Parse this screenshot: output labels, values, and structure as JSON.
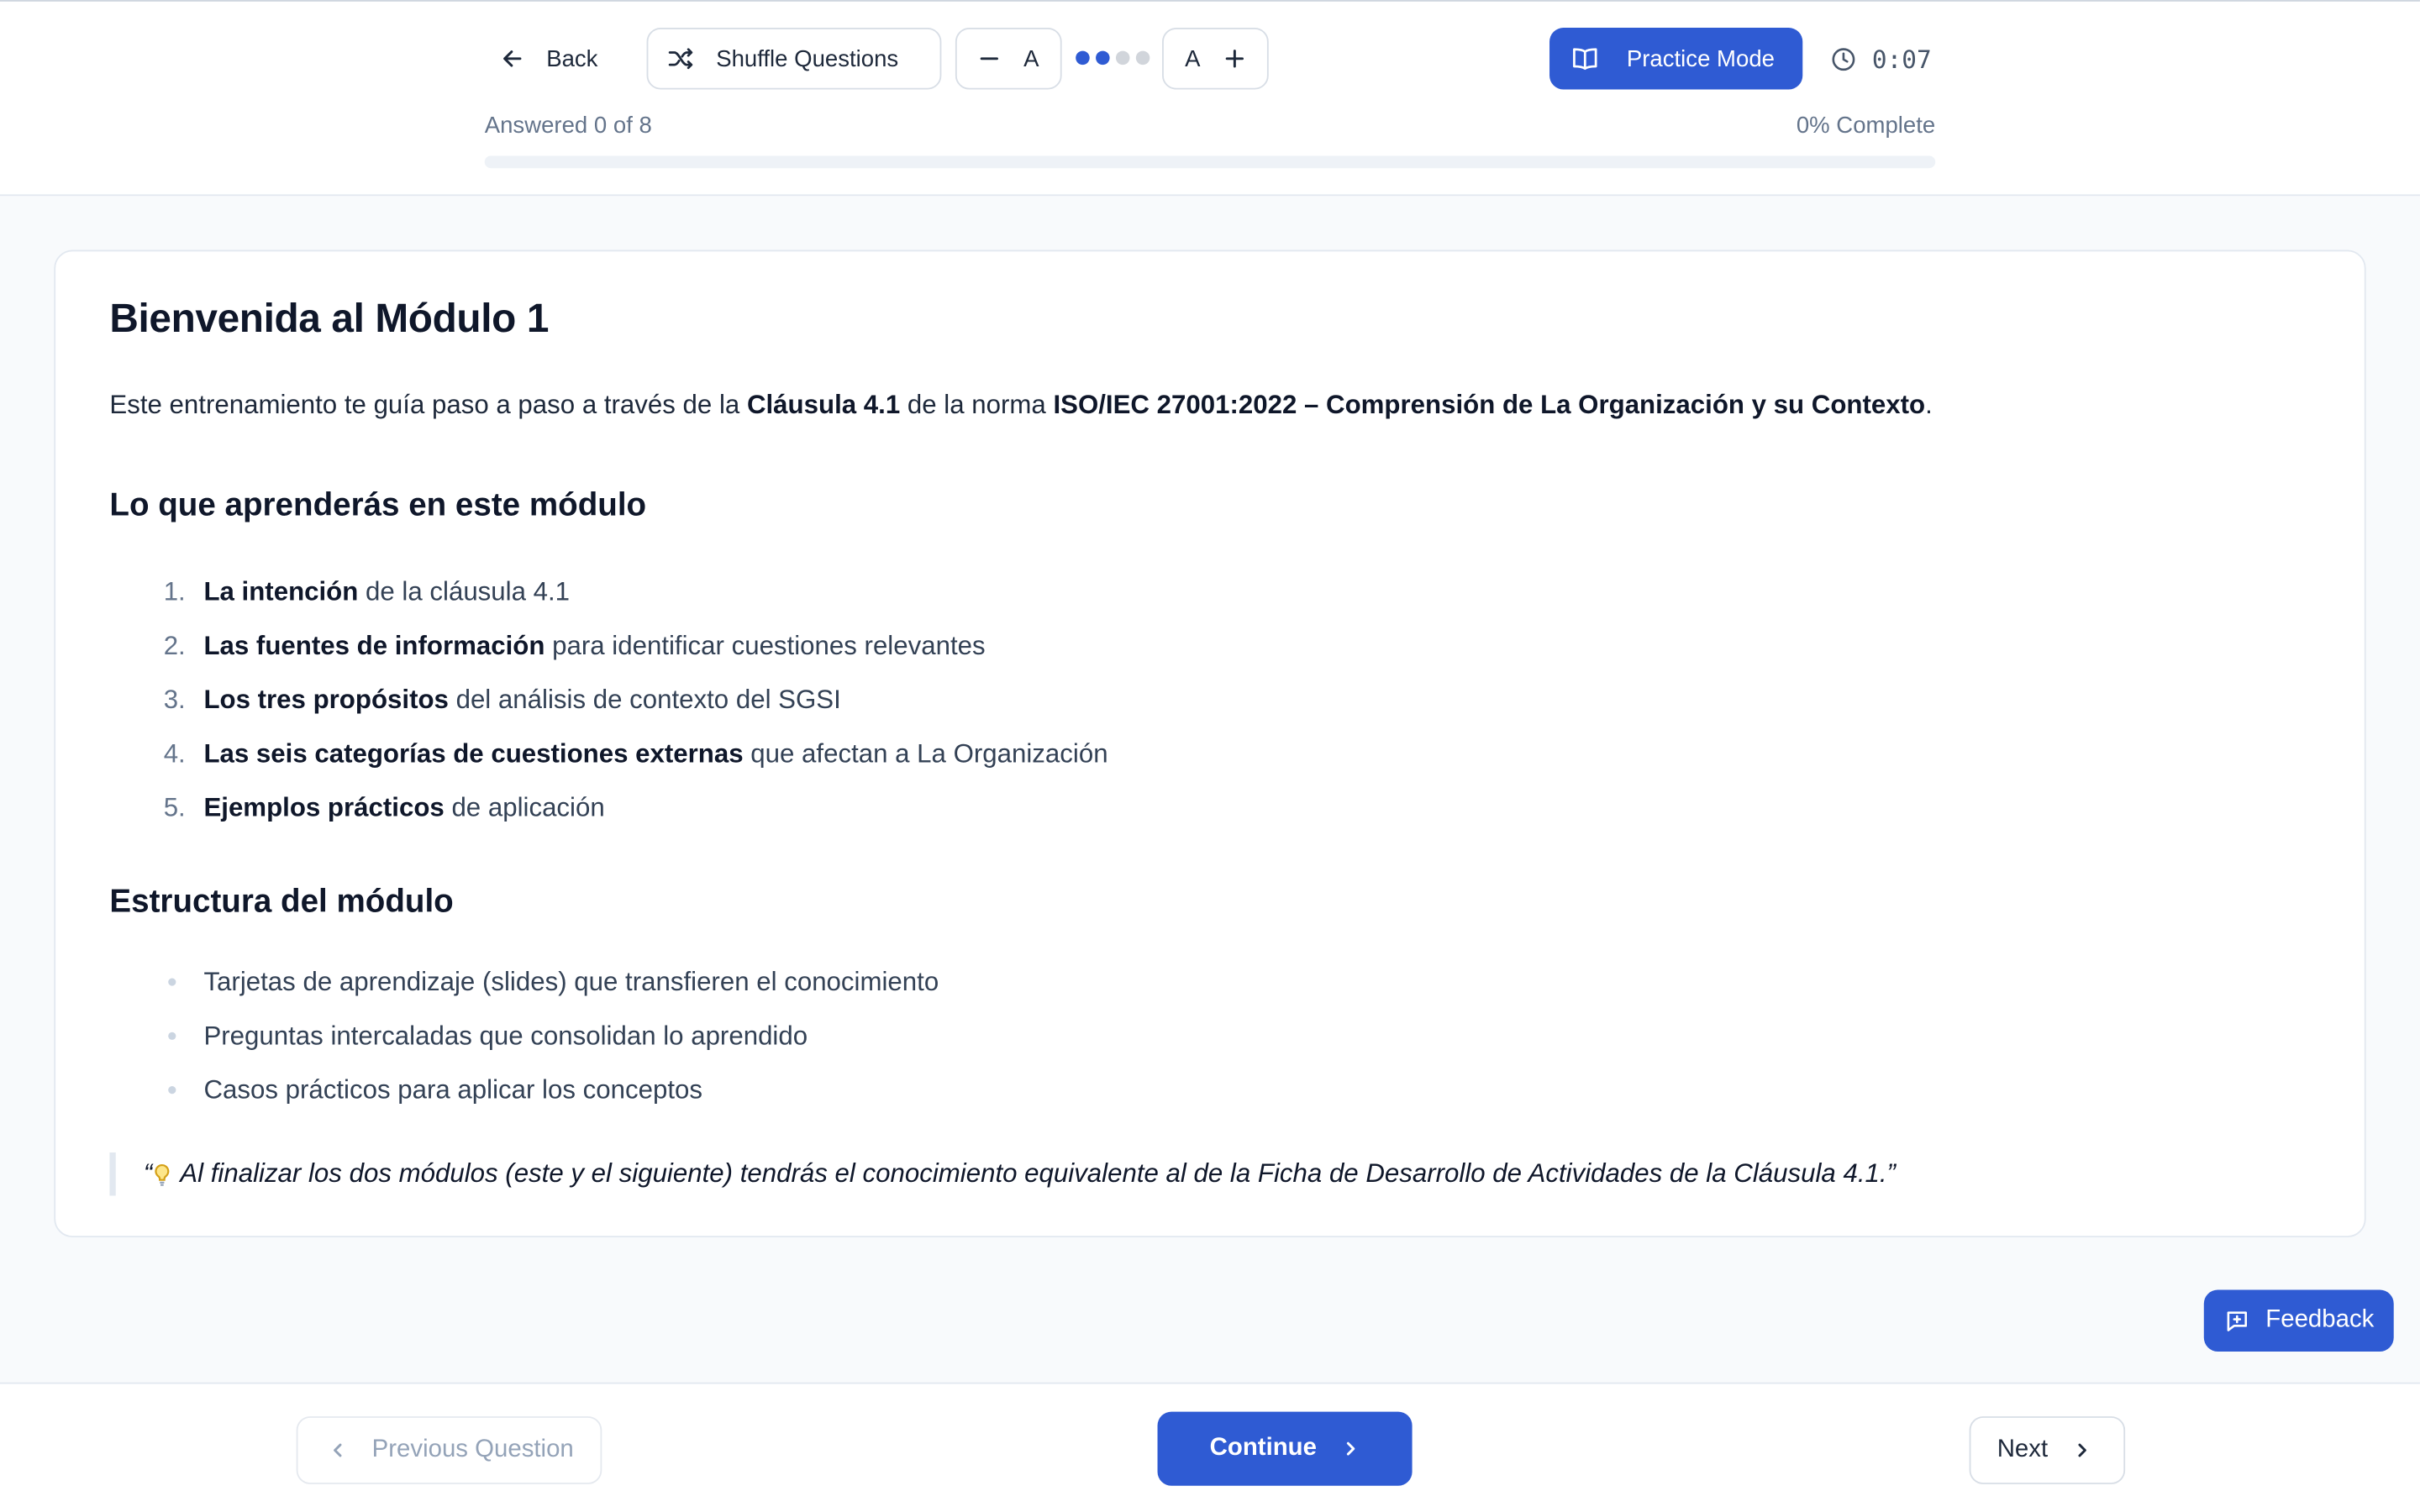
{
  "header": {
    "back_label": "Back",
    "shuffle_label": "Shuffle Questions",
    "font_decrease_glyph": "A",
    "font_increase_glyph": "A",
    "font_size_level": 2,
    "font_size_levels": 4,
    "practice_mode_label": "Practice Mode",
    "timer": "0:07",
    "answered_text": "Answered 0 of 8",
    "complete_text": "0% Complete",
    "progress_fraction": 0.0
  },
  "card": {
    "title": "Bienvenida al Módulo 1",
    "intro": [
      {
        "t": "Este entrenamiento te guía paso a paso a través de la ",
        "b": false
      },
      {
        "t": "Cláusula 4.1",
        "b": true
      },
      {
        "t": " de la norma ",
        "b": false
      },
      {
        "t": "ISO/IEC 27001:2022 – Comprensión de La Organización y su Contexto",
        "b": true
      },
      {
        "t": ".",
        "b": false
      }
    ],
    "learn_heading": "Lo que aprenderás en este módulo",
    "learn_items": [
      {
        "num": "1.",
        "bold": "La intención",
        "rest": " de la cláusula 4.1"
      },
      {
        "num": "2.",
        "bold": "Las fuentes de información",
        "rest": " para identificar cuestiones relevantes"
      },
      {
        "num": "3.",
        "bold": "Los tres propósitos",
        "rest": " del análisis de contexto del SGSI"
      },
      {
        "num": "4.",
        "bold": "Las seis categorías de cuestiones externas",
        "rest": " que afectan a La Organización"
      },
      {
        "num": "5.",
        "bold": "Ejemplos prácticos",
        "rest": " de aplicación"
      }
    ],
    "structure_heading": "Estructura del módulo",
    "structure_items": [
      "Tarjetas de aprendizaje (slides) que transfieren el conocimiento",
      "Preguntas intercaladas que consolidan lo aprendido",
      "Casos prácticos para aplicar los conceptos"
    ],
    "quote": {
      "open": "“",
      "text": "Al finalizar los dos módulos (este y el siguiente) tendrás el conocimiento equivalente al de la Ficha de Desarrollo de Actividades de la Cláusula 4.1.",
      "close": "”"
    }
  },
  "feedback_label": "Feedback",
  "footer": {
    "previous_label": "Previous Question",
    "continue_label": "Continue",
    "next_label": "Next"
  },
  "colors": {
    "primary": "#2f5bd3",
    "muted_text": "#64748b"
  },
  "icons": [
    "arrow-left-icon",
    "shuffle-icon",
    "minus-icon",
    "plus-icon",
    "book-open-icon",
    "clock-icon",
    "lightbulb-icon",
    "message-square-icon",
    "chevron-left-icon",
    "chevron-right-icon"
  ]
}
